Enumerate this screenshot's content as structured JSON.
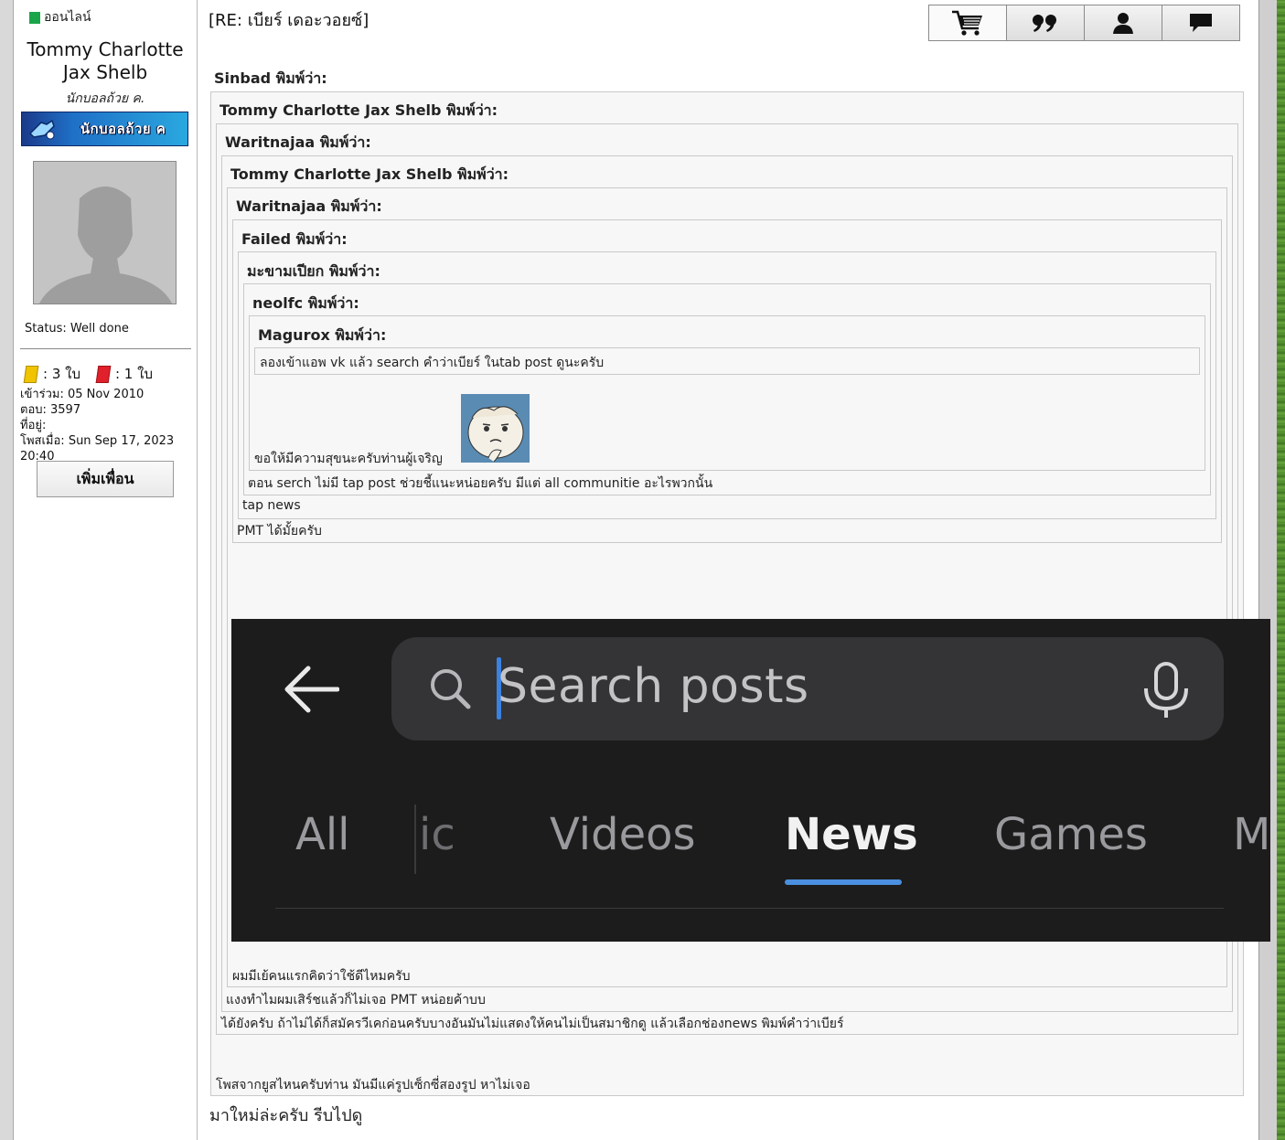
{
  "sidebar": {
    "online_label": "ออนไลน์",
    "username_line1": "Tommy Charlotte",
    "username_line2": "Jax Shelb",
    "rank": "นักบอลถ้วย ค.",
    "rank_banner": "นักบอลถ้วย ค",
    "status": "Status: Well done",
    "yellow_cards": ": 3 ใบ",
    "red_cards": ": 1 ใบ",
    "joined": "เข้าร่วม: 05 Nov 2010",
    "replies": "ตอบ: 3597",
    "location": "ที่อยู่:",
    "posted": "โพสเมื่อ: Sun Sep 17, 2023 20:40",
    "add_friend": "เพิ่มเพื่อน"
  },
  "post": {
    "title": "[RE: เบียร์ เดอะวอยซ์]",
    "toolbar_icons": [
      "cart-icon",
      "quote-icon",
      "user-icon",
      "message-icon"
    ]
  },
  "quotes": {
    "q1": "Sinbad พิมพ์ว่า:",
    "q2": "Tommy Charlotte Jax Shelb พิมพ์ว่า:",
    "q3": "Waritnajaa พิมพ์ว่า:",
    "q4": "Tommy Charlotte Jax Shelb พิมพ์ว่า:",
    "q5": "Waritnajaa พิมพ์ว่า:",
    "q6": "Failed พิมพ์ว่า:",
    "q7": "มะขามเปียก พิมพ์ว่า:",
    "q8": "neolfc พิมพ์ว่า:",
    "q9": "Magurox พิมพ์ว่า:"
  },
  "texts": {
    "magurox_msg": "ลองเข้าแอพ vk แล้ว search คำว่าเบียร์ ในtab post ดูนะครับ",
    "neolfc_msg": "ขอให้มีความสุขนะครับท่านผู้เจริญ",
    "makham_msg": "ตอน serch ไม่มี tap post ช่วยชี้แนะหน่อยครับ มีแต่ all communitie อะไรพวกนั้น",
    "failed_msg": "tap news",
    "waritnajaa_msg": "PMT ได้มั้ยครับ",
    "tommy_msg": "ผมมีเย้คนแรกคิดว่าใช้ดีไหมครับ",
    "waritnajaa2_msg": "แงงทำไมผมเสิร์ชแล้วก็ไม่เจอ PMT หน่อยค้าบบ",
    "tommy2_msg": "ได้ยังครับ ถ้าไม่ได้ก็สมัครวีเคก่อนครับบางอันมันไม่แสดงให้คนไม่เป็นสมาชิกดู แล้วเลือกช่องnews พิมพ์คำว่าเบียร์",
    "sinbad_msg": "โพสจากยูสไหนครับท่าน มันมีแค่รูปเซ็กซี่สองรูป หาไม่เจอ",
    "reply": "มาใหม่ล่ะครับ รีบไปดู"
  },
  "screenshot": {
    "search_placeholder": "Search posts",
    "tabs": [
      "All",
      "ic",
      "Videos",
      "News",
      "Games",
      "M"
    ],
    "active_tab": "News",
    "accent": "#4a8fe0"
  }
}
